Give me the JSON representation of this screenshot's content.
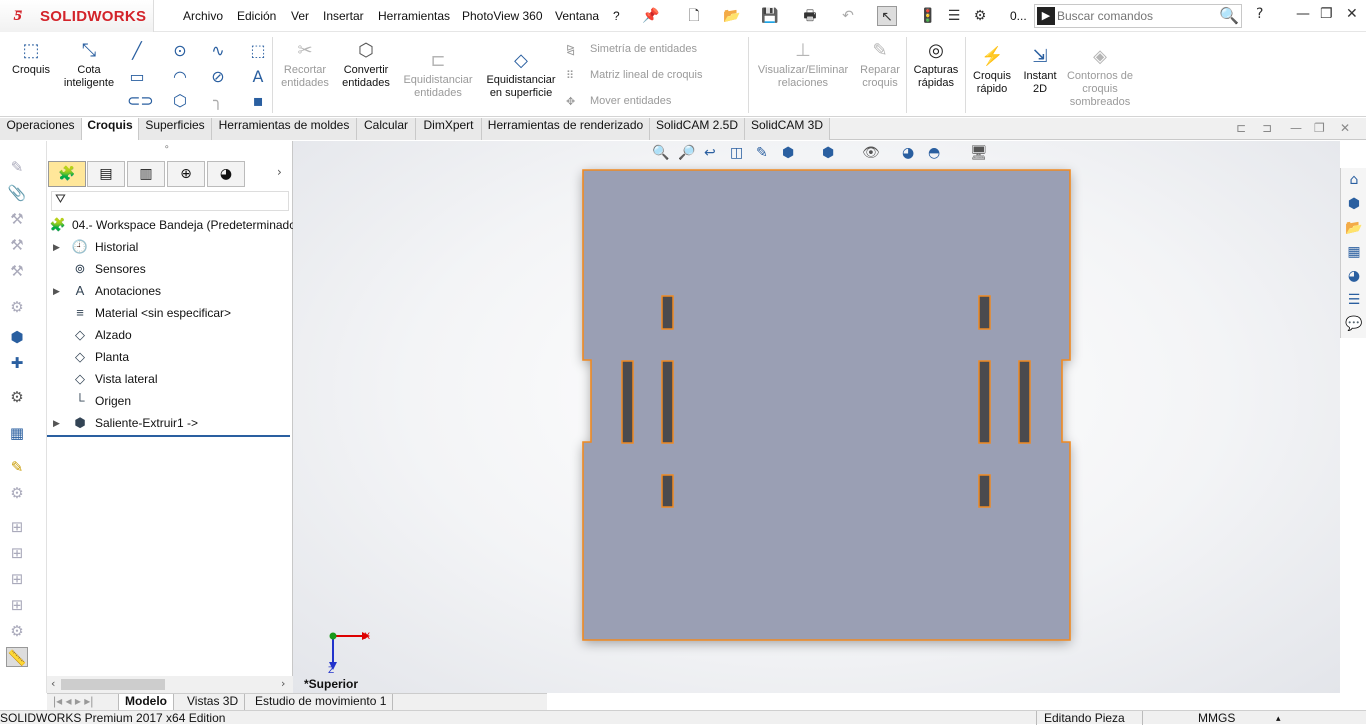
{
  "app": {
    "brand": "SOLIDWORKS",
    "menu": [
      "Archivo",
      "Edición",
      "Ver",
      "Insertar",
      "Herramientas",
      "PhotoView 360",
      "Ventana",
      "?"
    ],
    "search_placeholder": "Buscar comandos",
    "more_label": "0..."
  },
  "ribbon": {
    "croquis": "Croquis",
    "cota": "Cota inteligente",
    "recortar": "Recortar entidades",
    "convertir": "Convertir entidades",
    "equidistanciar": "Equidistanciar entidades",
    "equid_superficie": "Equidistanciar en superficie",
    "simetria": "Simetría de entidades",
    "matriz": "Matriz lineal de croquis",
    "mover": "Mover entidades",
    "visualizar": "Visualizar/Eliminar relaciones",
    "reparar": "Reparar croquis",
    "capturas": "Capturas rápidas",
    "croquis_rapido": "Croquis rápido",
    "instant2d": "Instant 2D",
    "contornos": "Contornos de croquis sombreados"
  },
  "tabs": [
    "Operaciones",
    "Croquis",
    "Superficies",
    "Herramientas de moldes",
    "Calcular",
    "DimXpert",
    "Herramientas de renderizado",
    "SolidCAM 2.5D",
    "SolidCAM 3D"
  ],
  "tree": {
    "root": "04.- Workspace Bandeja  (Predeterminado",
    "items": [
      {
        "label": "Historial",
        "icon": "history-icon",
        "expandable": true
      },
      {
        "label": "Sensores",
        "icon": "sensor-icon",
        "expandable": false
      },
      {
        "label": "Anotaciones",
        "icon": "annotation-icon",
        "expandable": true
      },
      {
        "label": "Material <sin especificar>",
        "icon": "material-icon",
        "expandable": false
      },
      {
        "label": "Alzado",
        "icon": "plane-icon",
        "expandable": false
      },
      {
        "label": "Planta",
        "icon": "plane-icon",
        "expandable": false
      },
      {
        "label": "Vista lateral",
        "icon": "plane-icon",
        "expandable": false
      },
      {
        "label": "Origen",
        "icon": "origin-icon",
        "expandable": false
      },
      {
        "label": "Saliente-Extruir1 ->",
        "icon": "extrude-icon",
        "expandable": true
      }
    ]
  },
  "bottom_tabs": [
    "Modelo",
    "Vistas 3D",
    "Estudio de movimiento 1"
  ],
  "viewport": {
    "view_label": "*Superior",
    "axis_x": "X",
    "axis_z": "Z"
  },
  "status": {
    "left": "SOLIDWORKS Premium 2017 x64 Edition",
    "mode": "Editando Pieza",
    "units": "MMGS"
  },
  "colors": {
    "part_face": "#9a9fb4",
    "part_edge": "#f08a22",
    "accent": "#2a5fa0",
    "brand": "#d3232a"
  }
}
